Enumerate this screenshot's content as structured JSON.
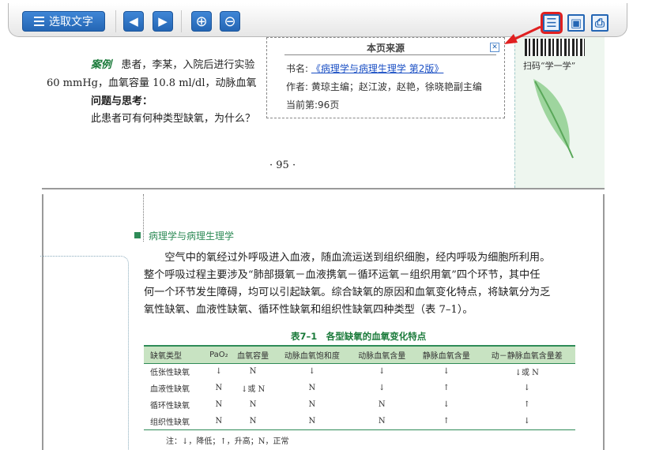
{
  "toolbar": {
    "select_text_label": "选取文字",
    "prev_icon": "◀",
    "next_icon": "▶",
    "zoom_in_icon": "⊕",
    "zoom_out_icon": "⊖",
    "source_icon": "☰",
    "save_icon": "▣",
    "print_icon": "⎙"
  },
  "page95": {
    "case_label": "案例",
    "line1": "患者，李某，入院后进行实验",
    "line2": "60 mmHg，血氧容量 10.8 ml/dl，动脉血氧",
    "question_title": "问题与思考：",
    "question_text": "此患者可有何种类型缺氧，为什么？",
    "qr_label": "扫码“学一学”",
    "page_number": "· 95 ·"
  },
  "source_popup": {
    "title": "本页来源",
    "close_icon": "✕",
    "book_label": "书名:",
    "book_link": "《病理学与病理生理学 第2版》",
    "author_line": "作者: 黄琼主编；赵江波，赵艳，徐晓艳副主编",
    "current_page": "当前第:96页"
  },
  "page96": {
    "section_title": "病理学与病理生理学",
    "paragraph_lines": [
      "　　空气中的氧经过外呼吸进入血液，随血流运送到组织细胞，经内呼吸为细胞所利用。",
      "整个呼吸过程主要涉及“肺部摄氧－血液携氧－循环运氧－组织用氧”四个环节，其中任",
      "何一个环节发生障碍，均可以引起缺氧。综合缺氧的原因和血氧变化特点，将缺氧分为乏",
      "氧性缺氧、血液性缺氧、循环性缺氧和组织性缺氧四种类型（表 7–1）。"
    ],
    "table_caption": "表7–1　各型缺氧的血氧变化特点",
    "table_headers": [
      "缺氧类型",
      "PaO₂",
      "血氧容量",
      "动脉血氧饱和度",
      "动脉血氧含量",
      "静脉血氧含量",
      "动－静脉血氧含量差"
    ],
    "table_rows": [
      [
        "低张性缺氧",
        "↓",
        "N",
        "↓",
        "↓",
        "↓",
        "↓或 N"
      ],
      [
        "血液性缺氧",
        "N",
        "↓或 N",
        "N",
        "↓",
        "↑",
        "↓"
      ],
      [
        "循环性缺氧",
        "N",
        "N",
        "N",
        "N",
        "↓",
        "↑"
      ],
      [
        "组织性缺氧",
        "N",
        "N",
        "N",
        "N",
        "↑",
        "↓"
      ]
    ],
    "table_note": "注：↓，降低；↑，升高；N，正常"
  }
}
